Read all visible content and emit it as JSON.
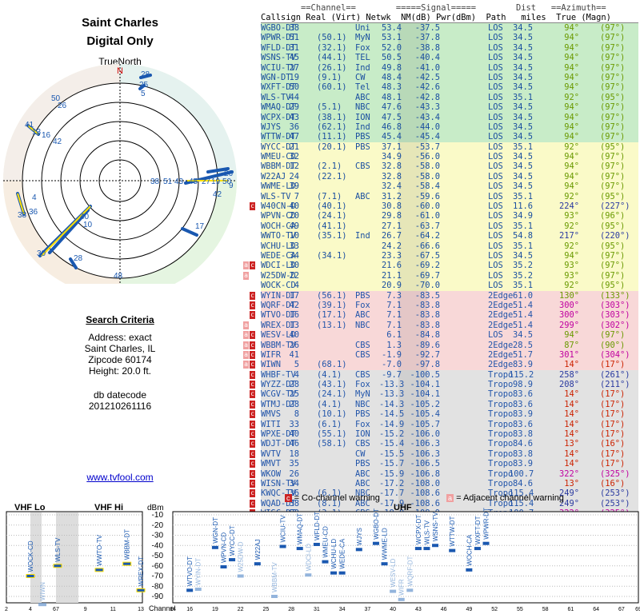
{
  "header": {
    "title1": "Saint Charles",
    "title2": "Digital Only",
    "truenorth": "TrueNorth",
    "n_mark": "N"
  },
  "search": {
    "heading": "Search Criteria",
    "address": "Address: exact",
    "city": "Saint Charles, IL",
    "zip": "Zipcode 60174",
    "height": "Height: 20.0 ft.",
    "db1": "db datecode",
    "db2": "201210261116",
    "link": "www.tvfool.com"
  },
  "table": {
    "header1": "        ==Channel==        =====Signal=====        Dist   ==Azimuth==",
    "header2": "Callsign Real (Virt) Netwk  NM(dB) Pwr(dBm)  Path   miles  True (Magn)",
    "rows": [
      [
        "WGBO-DT",
        "38",
        "",
        "Uni",
        "53.4",
        "-37.5",
        "LOS",
        "34.5",
        "94°",
        "(97°)",
        "g",
        ""
      ],
      [
        "WPWR-DT",
        "51",
        "(50.1)",
        "MyN",
        "53.1",
        "-37.8",
        "LOS",
        "34.5",
        "94°",
        "(97°)",
        "g",
        ""
      ],
      [
        "WFLD-DT",
        "31",
        "(32.1)",
        "Fox",
        "52.0",
        "-38.8",
        "LOS",
        "34.5",
        "94°",
        "(97°)",
        "g",
        ""
      ],
      [
        "WSNS-TV",
        "45",
        "(44.1)",
        "TEL",
        "50.5",
        "-40.4",
        "LOS",
        "34.5",
        "94°",
        "(97°)",
        "g",
        ""
      ],
      [
        "WCIU-TV",
        "27",
        "(26.1)",
        "Ind",
        "49.8",
        "-41.0",
        "LOS",
        "34.5",
        "94°",
        "(97°)",
        "g",
        ""
      ],
      [
        "WGN-DT",
        "19",
        "(9.1)",
        "CW",
        "48.4",
        "-42.5",
        "LOS",
        "34.5",
        "94°",
        "(97°)",
        "g",
        ""
      ],
      [
        "WXFT-DT",
        "50",
        "(60.1)",
        "Tel",
        "48.3",
        "-42.6",
        "LOS",
        "34.5",
        "94°",
        "(97°)",
        "g",
        ""
      ],
      [
        "WLS-TV",
        "44",
        "",
        "ABC",
        "48.1",
        "-42.8",
        "LOS",
        "35.1",
        "92°",
        "(95°)",
        "g",
        ""
      ],
      [
        "WMAQ-DT",
        "29",
        "(5.1)",
        "NBC",
        "47.6",
        "-43.3",
        "LOS",
        "34.5",
        "94°",
        "(97°)",
        "g",
        ""
      ],
      [
        "WCPX-DT",
        "43",
        "(38.1)",
        "ION",
        "47.5",
        "-43.4",
        "LOS",
        "34.5",
        "94°",
        "(97°)",
        "g",
        ""
      ],
      [
        "WJYS",
        "36",
        "(62.1)",
        "Ind",
        "46.8",
        "-44.0",
        "LOS",
        "34.5",
        "94°",
        "(97°)",
        "g",
        ""
      ],
      [
        "WTTW-DT",
        "47",
        "(11.1)",
        "PBS",
        "45.4",
        "-45.4",
        "LOS",
        "34.5",
        "94°",
        "(97°)",
        "g",
        ""
      ],
      [
        "WYCC-DT",
        "21",
        "(20.1)",
        "PBS",
        "37.1",
        "-53.7",
        "LOS",
        "35.1",
        "92°",
        "(95°)",
        "y",
        ""
      ],
      [
        "WMEU-CD",
        "32",
        "",
        "",
        "34.9",
        "-56.0",
        "LOS",
        "34.5",
        "94°",
        "(97°)",
        "y",
        ""
      ],
      [
        "WBBM-DT",
        "12",
        "(2.1)",
        "CBS",
        "32.8",
        "-58.0",
        "LOS",
        "34.5",
        "94°",
        "(97°)",
        "y",
        ""
      ],
      [
        "W22AJ",
        "24",
        "(22.1)",
        "",
        "32.8",
        "-58.0",
        "LOS",
        "34.5",
        "94°",
        "(97°)",
        "y",
        ""
      ],
      [
        "WWME-LD",
        "39",
        "",
        "",
        "32.4",
        "-58.4",
        "LOS",
        "34.5",
        "94°",
        "(97°)",
        "y",
        ""
      ],
      [
        "WLS-TV",
        "7",
        "(7.1)",
        "ABC",
        "31.2",
        "-59.6",
        "LOS",
        "35.1",
        "92°",
        "(95°)",
        "y",
        ""
      ],
      [
        "W40CN-D",
        "40",
        "(40.1)",
        "",
        "30.8",
        "-60.0",
        "LOS",
        "11.6",
        "224°",
        "(227°)",
        "y",
        "c"
      ],
      [
        "WPVN-CD",
        "20",
        "(24.1)",
        "",
        "29.8",
        "-61.0",
        "LOS",
        "34.9",
        "93°",
        "(96°)",
        "y",
        ""
      ],
      [
        "WOCH-CA",
        "49",
        "(41.1)",
        "",
        "27.1",
        "-63.7",
        "LOS",
        "35.1",
        "92°",
        "(95°)",
        "y",
        ""
      ],
      [
        "WWTO-TV",
        "10",
        "(35.1)",
        "Ind",
        "26.7",
        "-64.2",
        "LOS",
        "54.8",
        "217°",
        "(220°)",
        "y",
        ""
      ],
      [
        "WCHU-LD",
        "33",
        "",
        "",
        "24.2",
        "-66.6",
        "LOS",
        "35.1",
        "92°",
        "(95°)",
        "y",
        ""
      ],
      [
        "WEDE-CA",
        "34",
        "(34.1)",
        "",
        "23.3",
        "-67.5",
        "LOS",
        "34.5",
        "94°",
        "(97°)",
        "y",
        ""
      ],
      [
        "WDCI-LD",
        "30",
        "",
        "",
        "21.6",
        "-69.2",
        "LOS",
        "35.2",
        "93°",
        "(97°)",
        "y",
        "ac"
      ],
      [
        "W25DW-D",
        "22",
        "",
        "",
        "21.1",
        "-69.7",
        "LOS",
        "35.2",
        "93°",
        "(97°)",
        "y",
        "a"
      ],
      [
        "WOCK-CD",
        "4",
        "",
        "",
        "20.9",
        "-70.0",
        "LOS",
        "35.1",
        "92°",
        "(95°)",
        "y",
        ""
      ],
      [
        "WYIN-DT",
        "17",
        "(56.1)",
        "PBS",
        "7.3",
        "-83.5",
        "2Edge",
        "61.0",
        "130°",
        "(133°)",
        "p",
        "c"
      ],
      [
        "WQRF-DT",
        "42",
        "(39.1)",
        "Fox",
        "7.1",
        "-83.8",
        "2Edge",
        "51.4",
        "300°",
        "(303°)",
        "p",
        "c"
      ],
      [
        "WTVO-DT",
        "16",
        "(17.1)",
        "ABC",
        "7.1",
        "-83.8",
        "2Edge",
        "51.4",
        "300°",
        "(303°)",
        "p",
        "c"
      ],
      [
        "WREX-DT",
        "13",
        "(13.1)",
        "NBC",
        "7.1",
        "-83.8",
        "2Edge",
        "51.4",
        "299°",
        "(302°)",
        "p",
        "a"
      ],
      [
        "WESV-LD",
        "40",
        "",
        "",
        "6.1",
        "-84.8",
        "LOS",
        "34.5",
        "94°",
        "(97°)",
        "p",
        "ac"
      ],
      [
        "WBBM-TV",
        "26",
        "",
        "CBS",
        "1.3",
        "-89.6",
        "2Edge",
        "28.5",
        "87°",
        "(90°)",
        "p",
        "ac"
      ],
      [
        "WIFR",
        "41",
        "",
        "CBS",
        "-1.9",
        "-92.7",
        "2Edge",
        "51.7",
        "301°",
        "(304°)",
        "p",
        "ac"
      ],
      [
        "WIWN",
        "5",
        "(68.1)",
        "",
        "-7.0",
        "-97.8",
        "2Edge",
        "83.9",
        "14°",
        "(17°)",
        "p",
        "ac"
      ],
      [
        "WHBF-TV",
        "4",
        "(4.1)",
        "CBS",
        "-9.7",
        "-100.5",
        "Tropo",
        "115.2",
        "258°",
        "(261°)",
        "w",
        "c"
      ],
      [
        "WYZZ-DT",
        "28",
        "(43.1)",
        "Fox",
        "-13.3",
        "-104.1",
        "Tropo",
        "98.9",
        "208°",
        "(211°)",
        "w",
        "c"
      ],
      [
        "WCGV-TV",
        "25",
        "(24.1)",
        "MyN",
        "-13.3",
        "-104.1",
        "Tropo",
        "83.6",
        "14°",
        "(17°)",
        "w",
        "c"
      ],
      [
        "WTMJ-DT",
        "28",
        "(4.1)",
        "NBC",
        "-14.3",
        "-105.2",
        "Tropo",
        "83.6",
        "14°",
        "(17°)",
        "w",
        "c"
      ],
      [
        "WMVS",
        "8",
        "(10.1)",
        "PBS",
        "-14.5",
        "-105.4",
        "Tropo",
        "83.9",
        "14°",
        "(17°)",
        "w",
        "c"
      ],
      [
        "WITI",
        "33",
        "(6.1)",
        "Fox",
        "-14.9",
        "-105.7",
        "Tropo",
        "83.6",
        "14°",
        "(17°)",
        "w",
        "c"
      ],
      [
        "WPXE-DT",
        "40",
        "(55.1)",
        "ION",
        "-15.2",
        "-106.0",
        "Tropo",
        "83.8",
        "14°",
        "(17°)",
        "w",
        "c"
      ],
      [
        "WDJT-DT",
        "46",
        "(58.1)",
        "CBS",
        "-15.4",
        "-106.3",
        "Tropo",
        "84.6",
        "13°",
        "(16°)",
        "w",
        "c"
      ],
      [
        "WVTV",
        "18",
        "",
        "CW",
        "-15.5",
        "-106.3",
        "Tropo",
        "83.8",
        "14°",
        "(17°)",
        "w",
        "c"
      ],
      [
        "WMVT",
        "35",
        "",
        "PBS",
        "-15.7",
        "-106.5",
        "Tropo",
        "83.9",
        "14°",
        "(17°)",
        "w",
        "c"
      ],
      [
        "WKOW",
        "26",
        "",
        "ABC",
        "-15.9",
        "-106.8",
        "Tropo",
        "100.7",
        "322°",
        "(325°)",
        "w",
        "c"
      ],
      [
        "WISN-TV",
        "34",
        "",
        "ABC",
        "-17.2",
        "-108.0",
        "Tropo",
        "84.6",
        "13°",
        "(16°)",
        "w",
        "c"
      ],
      [
        "KWQC-TV",
        "36",
        "(6.1)",
        "NBC",
        "-17.7",
        "-108.6",
        "Tropo",
        "115.4",
        "249°",
        "(253°)",
        "w",
        "c"
      ],
      [
        "WQAD-DT",
        "38",
        "(8.1)",
        "ABC",
        "-17.9",
        "-108.6",
        "Tropo",
        "115.4",
        "249°",
        "(253°)",
        "w",
        "c"
      ],
      [
        "WISC-DT",
        "50",
        "(3.1)",
        "CBS",
        "-18.0",
        "-108.9",
        "Tropo",
        "100.7",
        "322°",
        "(325°)",
        "w",
        "c"
      ],
      [
        "WMLW-TV",
        "48",
        "(49.1)",
        "CBS",
        "-19.0",
        "-109.8",
        "Tropo",
        "84.6",
        "13°",
        "(16°)",
        "w",
        "c"
      ]
    ]
  },
  "legend": {
    "co_mark": "c",
    "co_text": "= Co-channel warning",
    "adj_mark": "a",
    "adj_text": "= Adjacent channel warning"
  },
  "spectrum": {
    "vhf_lo": "VHF Lo",
    "vhf_hi": "VHF Hi",
    "uhf": "UHF",
    "dbm_label": "dBm",
    "channel_label": "Channel",
    "y_ticks": [
      "-10",
      "-20",
      "-30",
      "-40",
      "-50",
      "-60",
      "-70",
      "-80",
      "-90"
    ],
    "vhf_lo_ticks": [
      "2",
      "4",
      "6"
    ],
    "vhf_hi_ticks": [
      "7",
      "9",
      "11",
      "13"
    ],
    "uhf_ticks": [
      "14",
      "16",
      "19",
      "22",
      "25",
      "28",
      "31",
      "34",
      "37",
      "40",
      "43",
      "46",
      "49",
      "52",
      "55",
      "58",
      "61",
      "64",
      "67",
      "69"
    ],
    "bars": [
      [
        "WOCK-CD",
        4,
        -70,
        "s"
      ],
      [
        "WIWN",
        5,
        -98,
        "w"
      ],
      [
        "WLS-TV",
        7,
        -60,
        "s"
      ],
      [
        "WWTO-TV",
        10,
        -64,
        "s"
      ],
      [
        "WBBM-DT",
        12,
        -58,
        "s"
      ],
      [
        "WREX-DT",
        13,
        -84,
        "s"
      ],
      [
        "WTVO-DT",
        16,
        -84,
        "s"
      ],
      [
        "WYIN-DT",
        17,
        -83,
        "w"
      ],
      [
        "WGN-DT",
        19,
        -42,
        "s"
      ],
      [
        "WPVN-CD",
        20,
        -61,
        "s"
      ],
      [
        "WYCC-DT",
        21,
        -54,
        "s"
      ],
      [
        "W25DW-D",
        22,
        -70,
        "w"
      ],
      [
        "W22AJ",
        24,
        -58,
        "s"
      ],
      [
        "WBBM-TV",
        26,
        -90,
        "w"
      ],
      [
        "WCIU-TV",
        27,
        -41,
        "s"
      ],
      [
        "WMAQ-DT",
        29,
        -43,
        "s"
      ],
      [
        "WDCI-LD",
        30,
        -69,
        "w"
      ],
      [
        "WFLD-DT",
        31,
        -39,
        "s"
      ],
      [
        "WMEU-CD",
        32,
        -56,
        "s"
      ],
      [
        "WCHU-LD",
        33,
        -67,
        "s"
      ],
      [
        "WEDE-CA",
        34,
        -67,
        "s"
      ],
      [
        "WJYS",
        36,
        -44,
        "s"
      ],
      [
        "WGBO-DT",
        38,
        -38,
        "s"
      ],
      [
        "WWME-LD",
        39,
        -58,
        "s"
      ],
      [
        "WESV-LD",
        40,
        -85,
        "w"
      ],
      [
        "WIFR",
        41,
        -93,
        "w"
      ],
      [
        "WQRF-DT",
        42,
        -84,
        "w"
      ],
      [
        "WCPX-DT",
        43,
        -43,
        "s"
      ],
      [
        "WLS-TV",
        44,
        -43,
        "s"
      ],
      [
        "WSNS-TV",
        45,
        -40,
        "s"
      ],
      [
        "WTTW-DT",
        47,
        -45,
        "s"
      ],
      [
        "WOCH-CA",
        49,
        -64,
        "s"
      ],
      [
        "WXFT-DT",
        50,
        -43,
        "s"
      ],
      [
        "WPWR-DT",
        51,
        -38,
        "s"
      ]
    ]
  },
  "polar": {
    "labels": [
      [
        "28",
        0,
        0
      ],
      [
        "25",
        0,
        0
      ],
      [
        "5",
        0,
        0
      ],
      [
        "50",
        0,
        0
      ],
      [
        "26",
        0,
        0
      ],
      [
        "41",
        0,
        0
      ],
      [
        "13",
        0,
        0
      ],
      [
        "16",
        0,
        0
      ],
      [
        "42",
        0,
        0
      ],
      [
        "4",
        0,
        0
      ],
      [
        "38",
        0,
        0
      ],
      [
        "36",
        0,
        0
      ],
      [
        "40",
        0,
        0
      ],
      [
        "10",
        0,
        0
      ],
      [
        "30",
        0,
        0
      ],
      [
        "28",
        0,
        0
      ],
      [
        "17",
        0,
        0
      ],
      [
        "48",
        0,
        0
      ],
      [
        "26",
        0,
        0
      ],
      [
        "38",
        0,
        0
      ],
      [
        "51",
        0,
        0
      ],
      [
        "43",
        0,
        0
      ],
      [
        "45",
        0,
        0
      ],
      [
        "27",
        0,
        0
      ],
      [
        "19",
        0,
        0
      ],
      [
        "50",
        0,
        0
      ],
      [
        "9",
        0,
        0
      ],
      [
        "42",
        0,
        0
      ]
    ]
  },
  "colors": {
    "g": "#c8ecc8",
    "y": "#fafac8",
    "p": "#f8d8d8",
    "w": "#e2e2e2",
    "co": "#cc2222",
    "adj": "#f0a0a0",
    "barStrong": "#1a58b0",
    "barWeak": "#93b4dc",
    "ring": "#000000"
  }
}
